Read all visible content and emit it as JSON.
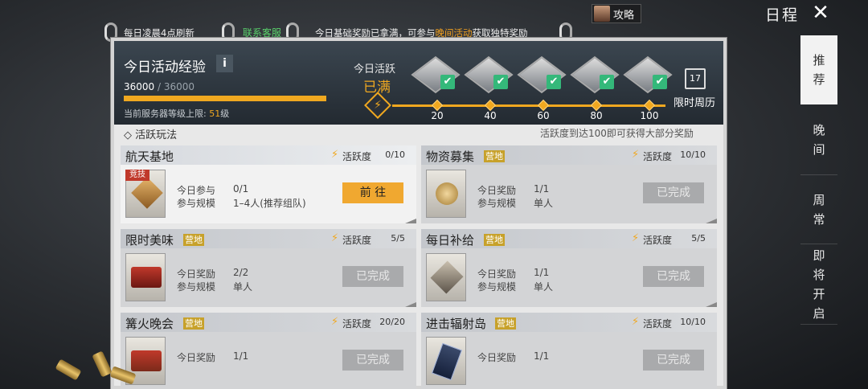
{
  "header": {
    "guide_label": "攻略",
    "title": "日程",
    "close_icon": "close-icon"
  },
  "side_tabs": [
    {
      "label": "推荐",
      "active": true
    },
    {
      "label": "晚间",
      "active": false
    },
    {
      "label": "周常",
      "active": false
    },
    {
      "label": "即将开启",
      "active": false
    }
  ],
  "strip": {
    "refresh": "每日凌晨4点刷新",
    "contact": "联系客服",
    "basic_msg_1": "今日基础奖励已拿满，可参与",
    "basic_msg_event": "晚间活动",
    "basic_msg_2": "获取独特奖励"
  },
  "experience": {
    "title": "今日活动经验",
    "info": "i",
    "current": "36000",
    "separator": " / ",
    "max": "36000",
    "progress": 1.0,
    "limit_prefix": "当前服务器等级上限: ",
    "limit_level": "51",
    "limit_suffix": "级"
  },
  "activity": {
    "label": "今日活跃",
    "status": "已满",
    "milestones": [
      "20",
      "40",
      "60",
      "80",
      "100"
    ],
    "weekly_icon_text": "17",
    "weekly_label": "限时周历"
  },
  "play": {
    "title": "◇ 活跃玩法",
    "hint": "活跃度到达100即可获得大部分奖励"
  },
  "cards": [
    {
      "name": "航天基地",
      "tag": "",
      "badge": "竞技",
      "activity_label": "活跃度",
      "activity_value": "0/10",
      "r1_label": "今日参与",
      "r1_value": "0/1",
      "r2_label": "参与规模",
      "r2_value": "1–4人(推荐组队)",
      "button": "前 往"
    },
    {
      "name": "物资募集",
      "tag": "营地",
      "badge": "",
      "activity_label": "活跃度",
      "activity_value": "10/10",
      "r1_label": "今日奖励",
      "r1_value": "1/1",
      "r2_label": "参与规模",
      "r2_value": "单人",
      "button": "已完成"
    },
    {
      "name": "限时美味",
      "tag": "营地",
      "badge": "",
      "activity_label": "活跃度",
      "activity_value": "5/5",
      "r1_label": "今日奖励",
      "r1_value": "2/2",
      "r2_label": "参与规模",
      "r2_value": "单人",
      "button": "已完成"
    },
    {
      "name": "每日补给",
      "tag": "营地",
      "badge": "",
      "activity_label": "活跃度",
      "activity_value": "5/5",
      "r1_label": "今日奖励",
      "r1_value": "1/1",
      "r2_label": "参与规模",
      "r2_value": "单人",
      "button": "已完成"
    },
    {
      "name": "篝火晚会",
      "tag": "营地",
      "badge": "",
      "activity_label": "活跃度",
      "activity_value": "20/20",
      "r1_label": "今日奖励",
      "r1_value": "1/1",
      "r2_label": "",
      "r2_value": "",
      "button": "已完成"
    },
    {
      "name": "进击辐射岛",
      "tag": "营地",
      "badge": "",
      "activity_label": "活跃度",
      "activity_value": "10/10",
      "r1_label": "今日奖励",
      "r1_value": "1/1",
      "r2_label": "",
      "r2_value": "",
      "button": "已完成"
    }
  ]
}
